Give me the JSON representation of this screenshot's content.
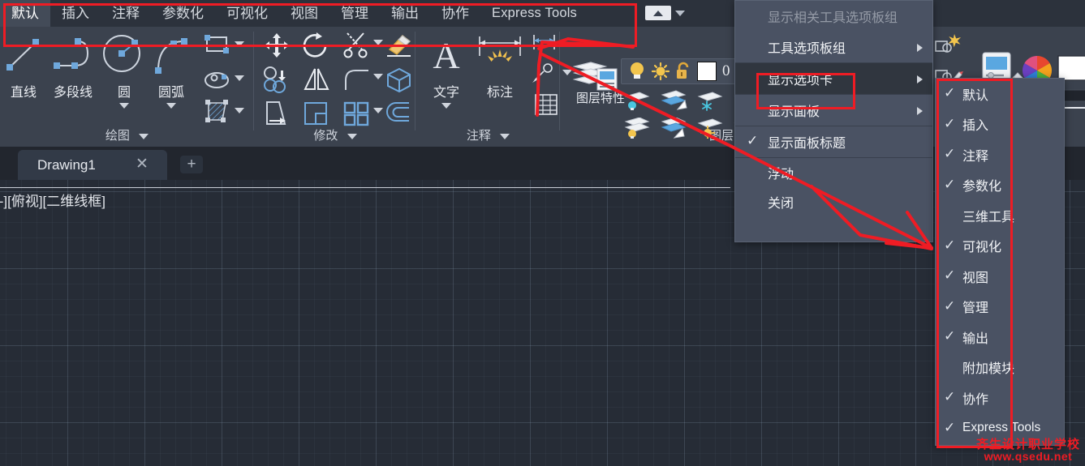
{
  "ribbon": {
    "tabs": [
      {
        "label": "默认",
        "active": true
      },
      {
        "label": "插入",
        "active": false
      },
      {
        "label": "注释",
        "active": false
      },
      {
        "label": "参数化",
        "active": false
      },
      {
        "label": "可视化",
        "active": false
      },
      {
        "label": "视图",
        "active": false
      },
      {
        "label": "管理",
        "active": false
      },
      {
        "label": "输出",
        "active": false
      },
      {
        "label": "协作",
        "active": false
      },
      {
        "label": "Express Tools",
        "active": false
      }
    ],
    "quick_access": {
      "collapse_icon": "up-arrow-icon",
      "dropdown_icon": "chevron-down-icon"
    },
    "panels": [
      {
        "id": "draw",
        "title": "绘图",
        "buttons": [
          {
            "label": "直线",
            "icon": "line-icon"
          },
          {
            "label": "多段线",
            "icon": "polyline-icon"
          },
          {
            "label": "圆",
            "icon": "circle-icon"
          },
          {
            "label": "圆弧",
            "icon": "arc-icon"
          }
        ],
        "small_icons": [
          "rectangle-icon",
          "ellipse-icon",
          "hatch-icon"
        ]
      },
      {
        "id": "modify",
        "title": "修改",
        "small_icons": [
          "move-icon",
          "rotate-icon",
          "trim-icon",
          "erase-icon",
          "copy-icon",
          "mirror-icon",
          "fillet-icon",
          "3d-box-icon",
          "stretch-icon",
          "scale-icon",
          "array-icon",
          "offset-icon"
        ]
      },
      {
        "id": "annotation",
        "title": "注释",
        "buttons": [
          {
            "label": "文字",
            "icon": "text-icon"
          },
          {
            "label": "标注",
            "icon": "dimension-icon"
          }
        ],
        "small_icons": [
          "linear-dim-icon",
          "leader-icon",
          "table-icon"
        ]
      },
      {
        "id": "layers",
        "title": "图层",
        "buttons": [
          {
            "label": "图层特性",
            "icon": "layer-properties-icon"
          }
        ],
        "layer_status": {
          "on_icon": "lightbulb-icon",
          "freeze_icon": "sun-icon",
          "lock_icon": "unlock-icon",
          "color_swatch": "#ffffff",
          "layer_name": "0"
        },
        "small_icons": [
          "layer-isolate-icon",
          "layer-make-current-icon",
          "layer-freeze-icon",
          "layer-lock-icon",
          "layer-off-icon",
          "layer-change-icon",
          "layer-thaw-icon",
          "layer-unlock-icon"
        ]
      },
      {
        "id": "properties",
        "title": "",
        "small_icons": [
          "match-properties-icon",
          "color-wheel-icon",
          "color-swatch-icon",
          "linetype-icon",
          "lineweight-icon"
        ]
      }
    ]
  },
  "document_bar": {
    "tab_name": "Drawing1",
    "close_icon": "close-icon",
    "add_icon": "plus-icon"
  },
  "canvas": {
    "viewport_label": "[-][俯视][二维线框]"
  },
  "context_menu": {
    "items": [
      {
        "label": "显示相关工具选项板组",
        "dimmed": true,
        "submenu": false,
        "checked": false,
        "selected": false
      },
      {
        "label": "工具选项板组",
        "dimmed": false,
        "submenu": true,
        "checked": false,
        "selected": false
      },
      {
        "label": "显示选项卡",
        "dimmed": false,
        "submenu": true,
        "checked": false,
        "selected": true
      },
      {
        "label": "显示面板",
        "dimmed": false,
        "submenu": true,
        "checked": false,
        "selected": false
      },
      {
        "label": "显示面板标题",
        "dimmed": false,
        "submenu": false,
        "checked": true,
        "selected": false
      },
      {
        "label": "浮动",
        "dimmed": false,
        "submenu": false,
        "checked": false,
        "selected": false
      },
      {
        "label": "关闭",
        "dimmed": false,
        "submenu": false,
        "checked": false,
        "selected": false
      }
    ]
  },
  "submenu": {
    "items": [
      {
        "label": "默认",
        "checked": true
      },
      {
        "label": "插入",
        "checked": true
      },
      {
        "label": "注释",
        "checked": true
      },
      {
        "label": "参数化",
        "checked": true
      },
      {
        "label": "三维工具",
        "checked": false
      },
      {
        "label": "可视化",
        "checked": true
      },
      {
        "label": "视图",
        "checked": true
      },
      {
        "label": "管理",
        "checked": true
      },
      {
        "label": "输出",
        "checked": true
      },
      {
        "label": "附加模块",
        "checked": false
      },
      {
        "label": "协作",
        "checked": true
      },
      {
        "label": "Express Tools",
        "checked": true
      }
    ],
    "check_glyph": "✓"
  },
  "annotations": {
    "highlight_color": "#ef1c24",
    "boxes": [
      "ribbon-tabbar-box",
      "show-tabs-item-box",
      "submenu-box"
    ],
    "arrows": [
      "annotation-panel-to-show-tabs-arrow",
      "show-panel-title-to-submenu-arrow"
    ]
  },
  "watermark": {
    "line1": "齐生设计职业学校",
    "line2": "www.qsedu.net"
  }
}
